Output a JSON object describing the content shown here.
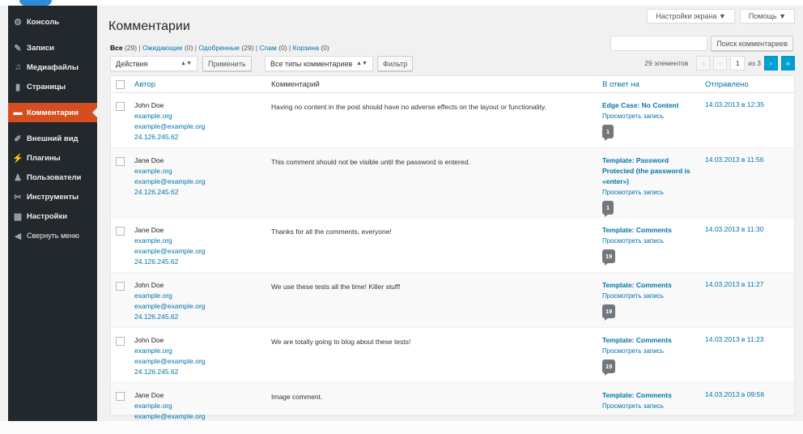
{
  "colors": {
    "admin_menu_bg": "#23282d",
    "active_menu": "#d54e21",
    "link": "#0073aa",
    "pagination_active": "#00a0d2"
  },
  "sidebar": {
    "items": [
      {
        "label": "Консоль",
        "icon": "dashboard-icon",
        "glyph": "⚙"
      },
      {
        "label": "Записи",
        "icon": "pin-icon",
        "glyph": "✎"
      },
      {
        "label": "Медиафайлы",
        "icon": "media-icon",
        "glyph": "♫"
      },
      {
        "label": "Страницы",
        "icon": "page-icon",
        "glyph": "▮"
      },
      {
        "label": "Комментарии",
        "icon": "comment-icon",
        "glyph": "▬",
        "active": true
      },
      {
        "label": "Внешний вид",
        "icon": "brush-icon",
        "glyph": "✐"
      },
      {
        "label": "Плагины",
        "icon": "plugin-icon",
        "glyph": "⚡"
      },
      {
        "label": "Пользователи",
        "icon": "user-icon",
        "glyph": "♟"
      },
      {
        "label": "Инструменты",
        "icon": "wrench-icon",
        "glyph": "✂"
      },
      {
        "label": "Настройки",
        "icon": "settings-icon",
        "glyph": "▦"
      }
    ],
    "collapse": {
      "label": "Свернуть меню",
      "icon": "collapse-icon",
      "glyph": "◀"
    }
  },
  "screen_meta": {
    "screen_options": "Настройки экрана ▼",
    "help": "Помощь ▼"
  },
  "page_title": "Комментарии",
  "filters": {
    "all": "Все",
    "all_count": "(29)",
    "pending": "Ожидающие",
    "pending_count": "(0)",
    "approved": "Одобренные",
    "approved_count": "(29)",
    "spam": "Спам",
    "spam_count": "(0)",
    "trash": "Корзина",
    "trash_count": "(0)",
    "sep": "|"
  },
  "search": {
    "button": "Поиск комментариев",
    "value": ""
  },
  "tablenav": {
    "bulk_action": "Действия",
    "apply": "Применить",
    "comment_type": "Все типы комментариев",
    "filter": "Фильтр",
    "items_count": "29 элементов",
    "first": "«",
    "prev": "‹",
    "current_page": "1",
    "of_pages": "из 3",
    "next": "›",
    "last": "»"
  },
  "columns": {
    "author": "Автор",
    "comment": "Комментарий",
    "response": "В ответ на",
    "submitted": "Отправлено"
  },
  "comments": [
    {
      "author": "John Doe",
      "url": "example.org",
      "email": "example@example.org",
      "ip": "24.126.245.62",
      "text": "Having no content in the post should have no adverse effects on the layout or functionality.",
      "post": "Edge Case: No Content",
      "view": "Просмотреть запись",
      "count": "1",
      "date": "14.03.2013 в 12:35"
    },
    {
      "author": "Jane Doe",
      "url": "example.org",
      "email": "example@example.org",
      "ip": "24.126.245.62",
      "text": "This comment should not be visible until the password is entered.",
      "post": "Template: Password Protected (the password is «enter»)",
      "view": "Просмотреть запись",
      "count": "1",
      "date": "14.03.2013 в 11:56"
    },
    {
      "author": "Jane Doe",
      "url": "example.org",
      "email": "example@example.org",
      "ip": "24.126.245.62",
      "text": "Thanks for all the comments, everyone!",
      "post": "Template: Comments",
      "view": "Просмотреть запись",
      "count": "19",
      "date": "14.03.2013 в 11:30"
    },
    {
      "author": "John Doe",
      "url": "example.org",
      "email": "example@example.org",
      "ip": "24.126.245.62",
      "text": "We use these tests all the time! Killer stuff!",
      "post": "Template: Comments",
      "view": "Просмотреть запись",
      "count": "19",
      "date": "14.03.2013 в 11:27"
    },
    {
      "author": "John Doe",
      "url": "example.org",
      "email": "example@example.org",
      "ip": "24.126.245.62",
      "text": "We are totally going to blog about these tests!",
      "post": "Template: Comments",
      "view": "Просмотреть запись",
      "count": "19",
      "date": "14.03.2013 в 11:23"
    },
    {
      "author": "Jane Doe",
      "url": "example.org",
      "email": "example@example.org",
      "ip": "",
      "text": "Image comment.",
      "post": "Template: Comments",
      "view": "Просмотреть запись",
      "count": "",
      "date": "14.03.2013 в 09:56"
    }
  ]
}
